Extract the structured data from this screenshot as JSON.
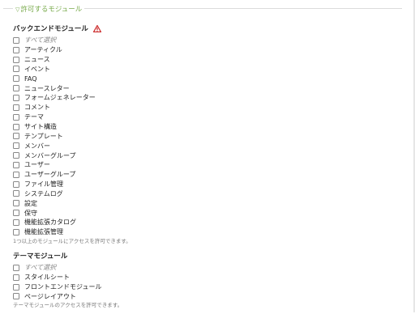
{
  "legend": "許可するモジュール",
  "backend": {
    "title": "バックエンドモジュール",
    "select_all": "すべて選択",
    "items": [
      "アーティクル",
      "ニュース",
      "イベント",
      "FAQ",
      "ニュースレター",
      "フォームジェネレーター",
      "コメント",
      "テーマ",
      "サイト構造",
      "テンプレート",
      "メンバー",
      "メンバーグループ",
      "ユーザー",
      "ユーザーグループ",
      "ファイル管理",
      "システムログ",
      "設定",
      "保守",
      "機能拡張カタログ",
      "機能拡張管理"
    ],
    "help": "1つ以上のモジュールにアクセスを許可できます。"
  },
  "theme": {
    "title": "テーマモジュール",
    "select_all": "すべて選択",
    "items": [
      "スタイルシート",
      "フロントエンドモジュール",
      "ページレイアウト"
    ],
    "help": "テーマモジュールのアクセスを許可できます。"
  },
  "icons": {
    "legend_toggle": "triangle-down-icon",
    "warning": "warning-triangle-icon"
  },
  "colors": {
    "legend": "#78aa4b",
    "warning": "#cc2a2a"
  }
}
